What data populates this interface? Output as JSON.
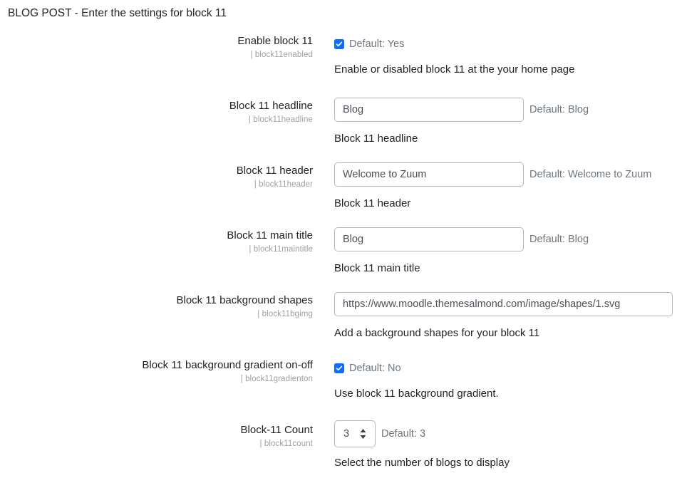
{
  "page": {
    "heading": "BLOG POST - Enter the settings for block 11"
  },
  "icons": {
    "checkmark": "check-icon",
    "stepper": "spinner-arrows-icon"
  },
  "colors": {
    "checkbox_accent": "#0d6efd",
    "muted_text": "#6c757d",
    "key_text": "#9aa0a6",
    "input_border": "#b3b6ba",
    "body_text": "#1d2125"
  },
  "settings": [
    {
      "label": "Enable block 11",
      "key": "| block11enabled",
      "control": "checkbox",
      "checked": true,
      "default_note": "Default: Yes",
      "description": "Enable or disabled block 11 at the your home page"
    },
    {
      "label": "Block 11 headline",
      "key": "| block11headline",
      "control": "text",
      "value": "Blog",
      "placeholder": "Blog",
      "default_note": "Default: Blog",
      "description": "Block 11 headline"
    },
    {
      "label": "Block 11 header",
      "key": "| block11header",
      "control": "text",
      "value": "Welcome to Zuum",
      "placeholder": "Welcome to Zuum",
      "default_note": "Default: Welcome to Zuum",
      "description": "Block 11 header"
    },
    {
      "label": "Block 11 main title",
      "key": "| block11maintitle",
      "control": "text",
      "value": "Blog",
      "placeholder": "Blog",
      "default_note": "Default: Blog",
      "description": "Block 11 main title"
    },
    {
      "label": "Block 11 background shapes",
      "key": "| block11bgimg",
      "control": "text-wide",
      "value": "https://www.moodle.themesalmond.com/image/shapes/1.svg",
      "placeholder": "https://www.moodle.themesalmond.com/image/shapes/1.svg",
      "default_note": "",
      "description": "Add a background shapes for your block 11"
    },
    {
      "label": "Block 11 background gradient on-off",
      "key": "| block11gradienton",
      "control": "checkbox",
      "checked": true,
      "default_note": "Default: No",
      "description": "Use block 11 background gradient."
    },
    {
      "label": "Block-11 Count",
      "key": "| block11count",
      "control": "number",
      "value": "3",
      "default_note": "Default: 3",
      "description": "Select the number of blogs to display"
    }
  ]
}
